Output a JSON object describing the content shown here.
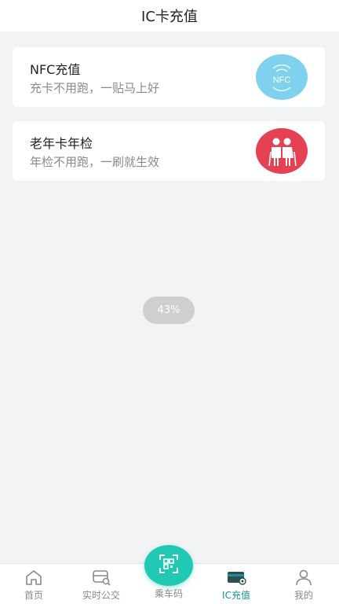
{
  "header": {
    "title": "IC卡充值"
  },
  "cards": [
    {
      "title": "NFC充值",
      "subtitle": "充卡不用跑，一贴马上好",
      "badge_text": "NFC",
      "badge_icon": "nfc-icon",
      "badge_color": "#7fd1ee"
    },
    {
      "title": "老年卡年检",
      "subtitle": "年检不用跑，一刷就生效",
      "badge_icon": "elderly-couple-icon",
      "badge_color": "#e64153"
    }
  ],
  "loading": {
    "percent_label": "43%"
  },
  "tabbar": {
    "items": [
      {
        "label": "首页",
        "icon": "home-icon"
      },
      {
        "label": "实时公交",
        "icon": "bus-search-icon"
      },
      {
        "label": "乘车码",
        "icon": "qr-code-icon"
      },
      {
        "label": "IC充值",
        "icon": "card-icon",
        "active": true
      },
      {
        "label": "我的",
        "icon": "user-icon"
      }
    ],
    "active_color": "#1a8fa0",
    "center_color": "#21c9b4"
  }
}
